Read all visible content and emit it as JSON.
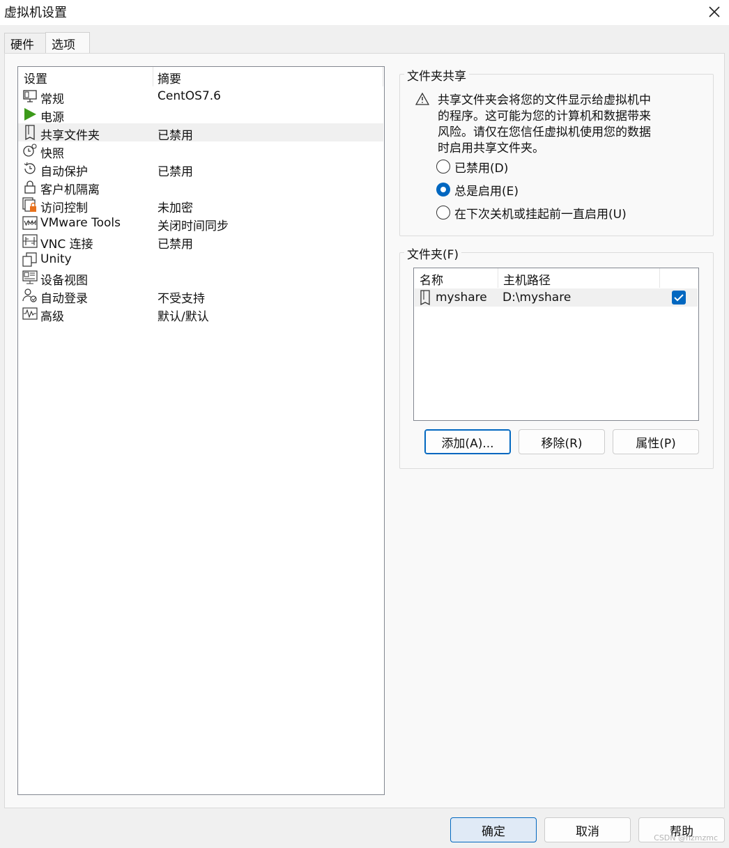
{
  "window": {
    "title": "虚拟机设置"
  },
  "tabs": [
    {
      "label": "硬件",
      "active": false
    },
    {
      "label": "选项",
      "active": true
    }
  ],
  "settings_list": {
    "columns": [
      "设置",
      "摘要"
    ],
    "rows": [
      {
        "icon": "monitor-icon",
        "label": "常规",
        "summary": "CentOS7.6"
      },
      {
        "icon": "play-icon",
        "label": "电源",
        "summary": ""
      },
      {
        "icon": "shared-folder-icon",
        "label": "共享文件夹",
        "summary": "已禁用",
        "selected": true
      },
      {
        "icon": "snapshot-clock-icon",
        "label": "快照",
        "summary": ""
      },
      {
        "icon": "autoprotect-clock-icon",
        "label": "自动保护",
        "summary": "已禁用"
      },
      {
        "icon": "lock-icon",
        "label": "客户机隔离",
        "summary": ""
      },
      {
        "icon": "access-control-lock-icon",
        "label": "访问控制",
        "summary": "未加密"
      },
      {
        "icon": "vm-logo-icon",
        "label": "VMware Tools",
        "summary": "关闭时间同步"
      },
      {
        "icon": "vnc-icon",
        "label": "VNC 连接",
        "summary": "已禁用"
      },
      {
        "icon": "unity-icon",
        "label": "Unity",
        "summary": ""
      },
      {
        "icon": "appliance-view-icon",
        "label": "设备视图",
        "summary": ""
      },
      {
        "icon": "autologin-users-icon",
        "label": "自动登录",
        "summary": "不受支持"
      },
      {
        "icon": "advanced-waveform-icon",
        "label": "高级",
        "summary": "默认/默认"
      }
    ]
  },
  "folder_sharing": {
    "title": "文件夹共享",
    "warning": "共享文件夹会将您的文件显示给虚拟机中的程序。这可能为您的计算机和数据带来风险。请仅在您信任虚拟机使用您的数据时启用共享文件夹。",
    "options": [
      {
        "label": "已禁用(D)",
        "selected": false
      },
      {
        "label": "总是启用(E)",
        "selected": true
      },
      {
        "label": "在下次关机或挂起前一直启用(U)",
        "selected": false
      }
    ]
  },
  "folders": {
    "title": "文件夹(F)",
    "columns": [
      "名称",
      "主机路径"
    ],
    "rows": [
      {
        "name": "myshare",
        "path": "D:\\myshare",
        "enabled": true
      }
    ],
    "buttons": {
      "add": "添加(A)...",
      "remove": "移除(R)",
      "properties": "属性(P)"
    }
  },
  "footer": {
    "ok": "确定",
    "cancel": "取消",
    "help": "帮助"
  },
  "watermark": "CSDN @nzmzmc",
  "colors": {
    "accent": "#0067c0",
    "play_green": "#3c9a1a",
    "lock_orange": "#e8711c"
  }
}
